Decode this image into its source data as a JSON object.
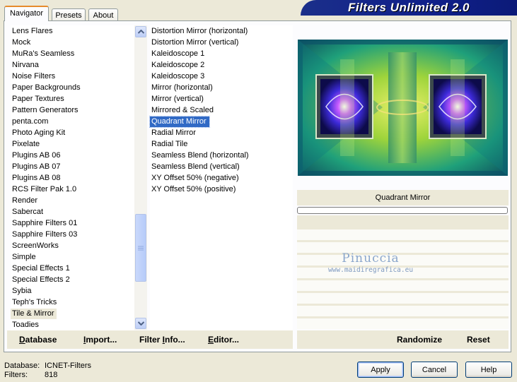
{
  "tabs": [
    "Navigator",
    "Presets",
    "About"
  ],
  "banner": "Filters Unlimited 2.0",
  "categories": [
    "Lens Flares",
    "Mock",
    "MuRa's Seamless",
    "Nirvana",
    "Noise Filters",
    "Paper Backgrounds",
    "Paper Textures",
    "Pattern Generators",
    "penta.com",
    "Photo Aging Kit",
    "Pixelate",
    "Plugins AB 06",
    "Plugins AB 07",
    "Plugins AB 08",
    "RCS Filter Pak 1.0",
    "Render",
    "Sabercat",
    "Sapphire Filters 01",
    "Sapphire Filters 03",
    "ScreenWorks",
    "Simple",
    "Special Effects 1",
    "Special Effects 2",
    "Sybia",
    "Teph's Tricks",
    "Tile & Mirror",
    "Toadies"
  ],
  "selected_category": "Tile & Mirror",
  "filters": [
    "Distortion Mirror (horizontal)",
    "Distortion Mirror (vertical)",
    "Kaleidoscope 1",
    "Kaleidoscope 2",
    "Kaleidoscope 3",
    "Mirror (horizontal)",
    "Mirror (vertical)",
    "Mirrored & Scaled",
    "Quadrant Mirror",
    "Radial Mirror",
    "Radial Tile",
    "Seamless Blend (horizontal)",
    "Seamless Blend (vertical)",
    "XY Offset 50% (negative)",
    "XY Offset 50% (positive)"
  ],
  "selected_filter": "Quadrant Mirror",
  "preview": {
    "filter_name": "Quadrant Mirror",
    "progress": 0
  },
  "watermark": {
    "name": "Pinuccia",
    "url": "www.maidiregrafica.eu"
  },
  "links": {
    "database": {
      "accel": "D",
      "rest": "atabase"
    },
    "import": {
      "accel": "I",
      "rest": "mport..."
    },
    "filter_info": {
      "pre": "Filter ",
      "accel": "I",
      "rest": "nfo..."
    },
    "editor": {
      "accel": "E",
      "rest": "ditor..."
    },
    "randomize": "Randomize",
    "reset": "Reset"
  },
  "status": {
    "database_label": "Database:",
    "database_value": "ICNET-Filters",
    "filters_label": "Filters:",
    "filters_value": "818"
  },
  "buttons": {
    "apply": "Apply",
    "cancel": "Cancel",
    "help": "Help"
  },
  "icons": {
    "scroll_up": "arrow-up-icon",
    "scroll_down": "arrow-down-icon"
  }
}
